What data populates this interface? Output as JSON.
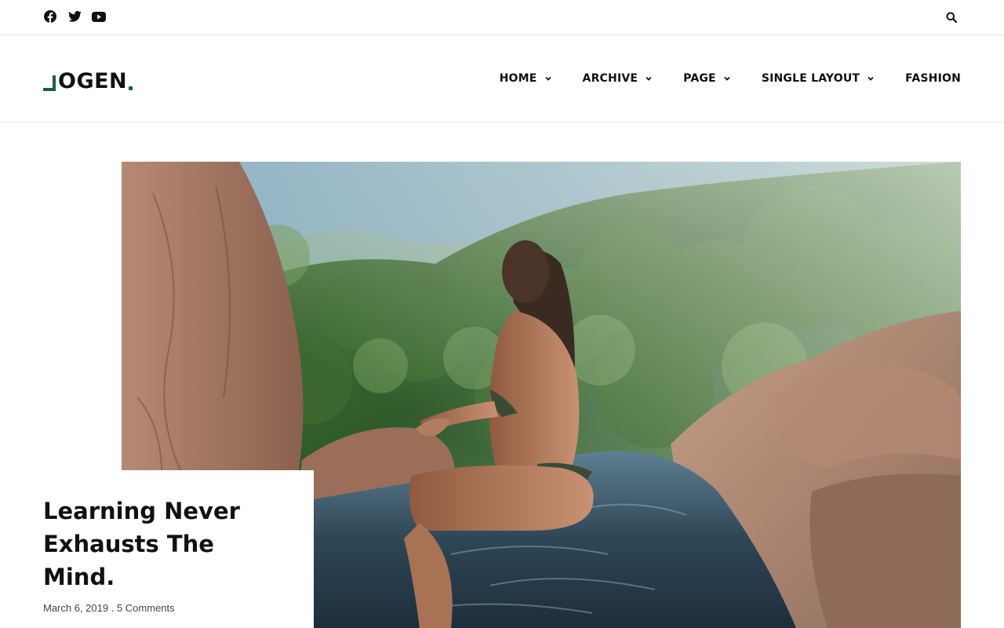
{
  "topbar": {
    "social_icons": [
      "facebook-icon",
      "twitter-icon",
      "youtube-icon"
    ],
    "search_icon": "search-icon"
  },
  "brand": {
    "logo_text": "OGEN",
    "accent_color": "#1e5e3f"
  },
  "nav": {
    "items": [
      {
        "label": "HOME",
        "has_dropdown": true
      },
      {
        "label": "ARCHIVE",
        "has_dropdown": true
      },
      {
        "label": "PAGE",
        "has_dropdown": true
      },
      {
        "label": "SINGLE LAYOUT",
        "has_dropdown": true
      },
      {
        "label": "FASHION",
        "has_dropdown": false
      }
    ]
  },
  "post": {
    "title": "Learning Never Exhausts The Mind.",
    "date": "March 6, 2019",
    "separator": " . ",
    "comments": "5 Comments"
  }
}
